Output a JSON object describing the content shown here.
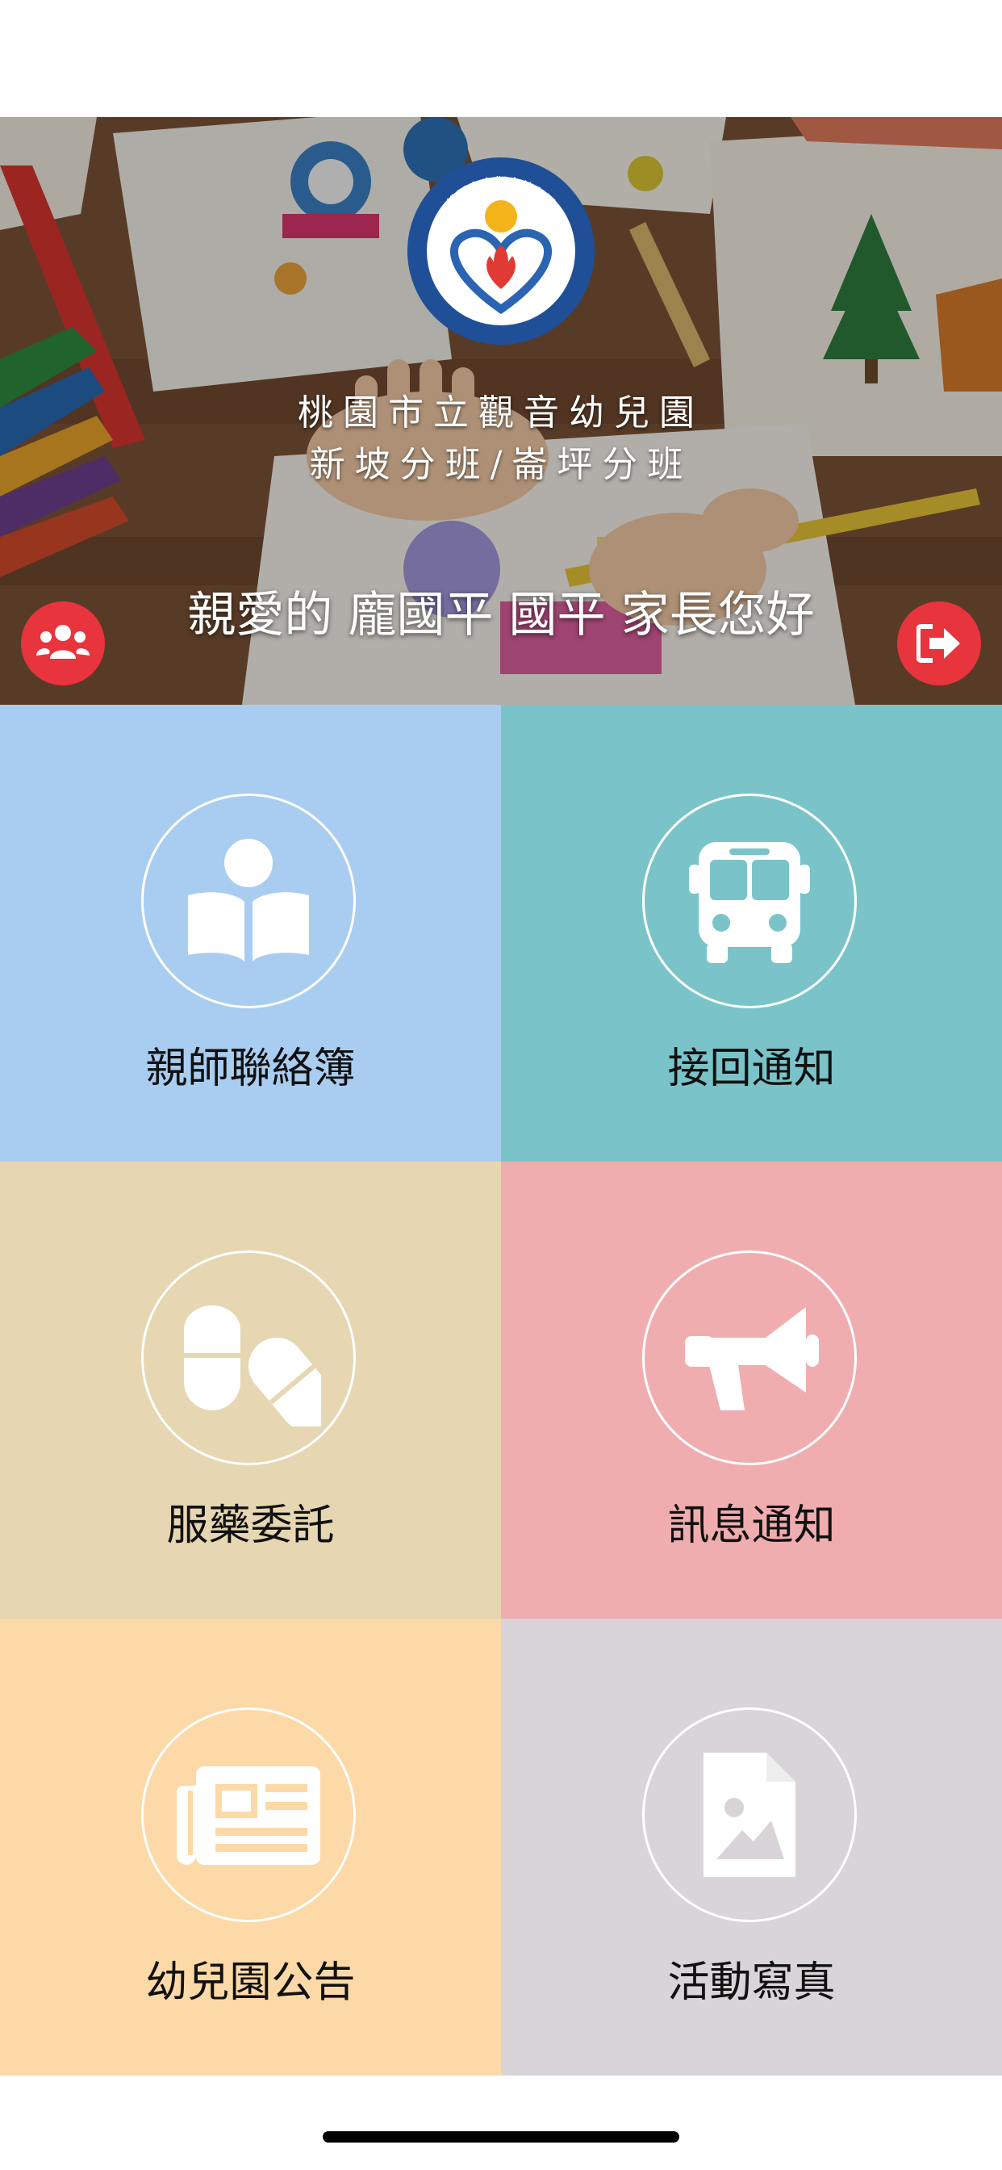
{
  "header": {
    "school_name_line1": "桃園市立觀音幼兒園",
    "school_name_line2": "新坡分班/崙坪分班",
    "logo_text": "桃園市立觀音幼兒園",
    "greeting": "親愛的 龐國平 國平 家長您好"
  },
  "buttons": {
    "group_icon": "users-group-icon",
    "logout_icon": "logout-icon"
  },
  "tiles": [
    {
      "label": "親師聯絡簿",
      "icon": "reading-book-icon",
      "color": "#a9cdf0"
    },
    {
      "label": "接回通知",
      "icon": "bus-icon",
      "color": "#7ac4c9"
    },
    {
      "label": "服藥委託",
      "icon": "pills-icon",
      "color": "#e6d6b2"
    },
    {
      "label": "訊息通知",
      "icon": "megaphone-icon",
      "color": "#f0adb0"
    },
    {
      "label": "幼兒園公告",
      "icon": "newspaper-icon",
      "color": "#fcd9a7"
    },
    {
      "label": "活動寫真",
      "icon": "image-file-icon",
      "color": "#d8d4d8"
    }
  ],
  "colors": {
    "accent_red": "#e8343c"
  }
}
